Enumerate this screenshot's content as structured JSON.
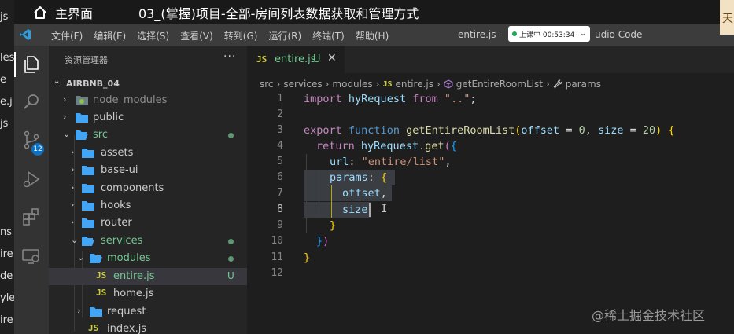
{
  "overlay": {
    "home_label": "主界面",
    "lesson_title": "03_(掌握)项目-全部-房间列表数据获取和管理方式",
    "right_cut_char": "天"
  },
  "left_strip": [
    "js",
    "les",
    "e",
    "e.j",
    "js",
    "ns",
    "ire",
    "de",
    "yle",
    "ire"
  ],
  "titlebar": {
    "menus": [
      "文件(F)",
      "编辑(E)",
      "选择(S)",
      "查看(V)",
      "转到(G)",
      "运行(R)",
      "终端(T)",
      "帮助(H)"
    ],
    "title_left": "entire.js -",
    "title_right": "udio Code",
    "recording_label": "上课中 00:53:34"
  },
  "activity": {
    "scm_badge": "12"
  },
  "sidebar": {
    "header": "资源管理器",
    "more": "···",
    "root": "AIRBNB_04",
    "items": [
      {
        "label": "node_modules",
        "kind": "folder-special"
      },
      {
        "label": "public",
        "kind": "folder"
      },
      {
        "label": "src",
        "kind": "folder-open"
      },
      {
        "label": "assets",
        "kind": "folder"
      },
      {
        "label": "base-ui",
        "kind": "folder"
      },
      {
        "label": "components",
        "kind": "folder"
      },
      {
        "label": "hooks",
        "kind": "folder"
      },
      {
        "label": "router",
        "kind": "folder"
      },
      {
        "label": "services",
        "kind": "folder-open"
      },
      {
        "label": "modules",
        "kind": "folder-open"
      },
      {
        "label": "entire.js",
        "kind": "js",
        "status": "U"
      },
      {
        "label": "home.js",
        "kind": "js"
      },
      {
        "label": "request",
        "kind": "folder"
      },
      {
        "label": "index.js",
        "kind": "js"
      }
    ]
  },
  "editor": {
    "tab": {
      "label": "entire.js",
      "status": "U",
      "js_badge": "JS"
    },
    "breadcrumbs": [
      "src",
      "services",
      "modules",
      "entire.js",
      "getEntireRoomList",
      "params"
    ],
    "line_numbers": [
      "1",
      "2",
      "3",
      "4",
      "5",
      "6",
      "7",
      "8",
      "9",
      "10",
      "11",
      "12"
    ],
    "lines": {
      "l1": {
        "t1": "import",
        "t2": "hyRequest",
        "t3": "from",
        "t4": "\"..\"",
        "t5": ";"
      },
      "l3": {
        "t1": "export",
        "t2": "function",
        "t3": "getEntireRoomList",
        "t4": "(",
        "t5": "offset",
        "t6": " = ",
        "t7": "0",
        "t8": ", ",
        "t9": "size",
        "t10": " = ",
        "t11": "20",
        "t12": ")",
        "t13": " {"
      },
      "l4": {
        "t1": "return",
        "t2": "hyRequest",
        "t3": ".",
        "t4": "get",
        "t5": "(",
        "t6": "{"
      },
      "l5": {
        "t1": "url",
        "t2": ": ",
        "t3": "\"entire/list\"",
        "t4": ","
      },
      "l6": {
        "t1": "params",
        "t2": ": ",
        "t3": "{"
      },
      "l7": {
        "t1": "offset",
        "t2": ","
      },
      "l8": {
        "t1": "size"
      },
      "l9": {
        "t1": "}"
      },
      "l10": {
        "t1": "}",
        "t2": ")"
      },
      "l11": {
        "t1": "}"
      }
    }
  },
  "watermark": "@稀土掘金技术社区"
}
